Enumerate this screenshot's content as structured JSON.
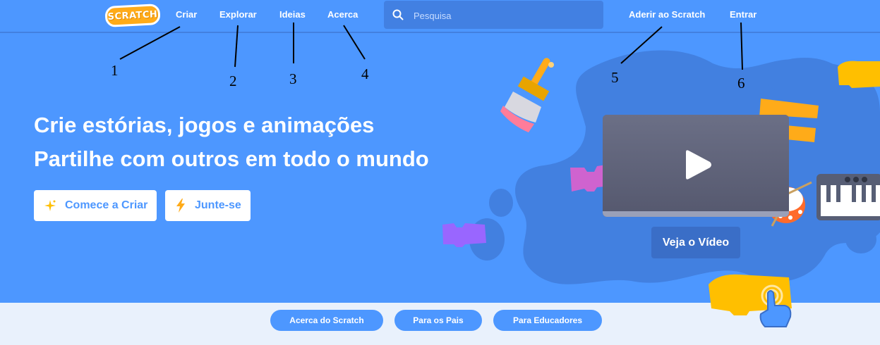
{
  "nav": {
    "logo": "SCRATCH",
    "links": [
      "Criar",
      "Explorar",
      "Ideias",
      "Acerca"
    ],
    "search_placeholder": "Pesquisa",
    "join": "Aderir ao Scratch",
    "signin": "Entrar"
  },
  "annotations": [
    "1",
    "2",
    "3",
    "4",
    "5",
    "6"
  ],
  "hero": {
    "line1": "Crie estórias, jogos e animações",
    "line2": "Partilhe com outros em todo o mundo",
    "start_button": "Comece a Criar",
    "join_button": "Junte-se",
    "video_button": "Veja o Vídeo"
  },
  "footer_pills": [
    "Acerca do Scratch",
    "Para os Pais",
    "Para Educadores"
  ],
  "colors": {
    "brand_blue": "#4d97ff",
    "search_bg": "#4280e2",
    "footer_bg": "#e9f1fc",
    "logo_orange": "#ffab19"
  }
}
